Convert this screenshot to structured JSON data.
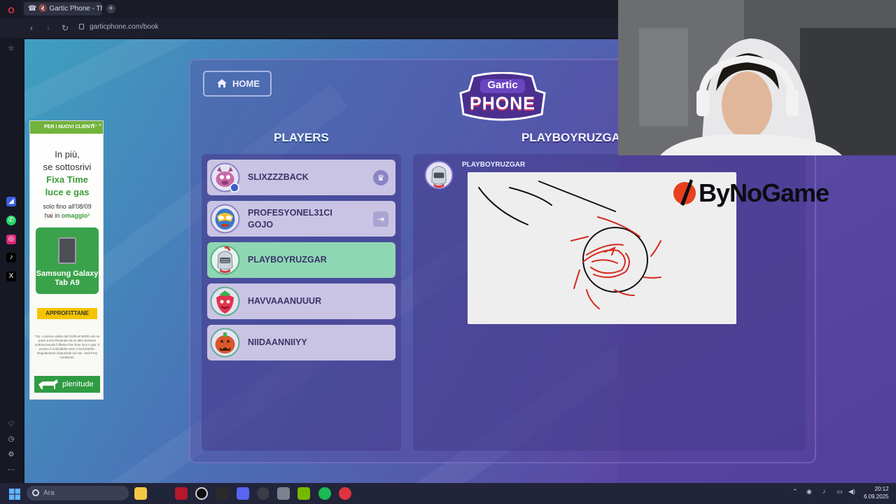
{
  "browser": {
    "tab_title": "☎ 🔇 Gartic Phone - The Te",
    "new_tab": "+",
    "url": "garticphone.com/book"
  },
  "game": {
    "home_label": "HOME",
    "logo_top": "Gartic",
    "logo_bottom": "PHONE",
    "players_title": "PLAYERS",
    "current_book_title": "PLAYBOYRUZGAR",
    "players": [
      {
        "name": "SLIXZZZBACK",
        "badge": "♛"
      },
      {
        "name": "PROFESYONEL31CI GOJO",
        "badge": "⇥"
      },
      {
        "name": "PLAYBOYRUZGAR",
        "badge": ""
      },
      {
        "name": "HAVVAAANUUUR",
        "badge": ""
      },
      {
        "name": "NIIDAANNIIYY",
        "badge": ""
      }
    ],
    "book_entry_author": "PLAYBOYRUZGAR"
  },
  "ad": {
    "top_label": "PER I NUOVI CLIENTI",
    "info": "i▷ ×",
    "line1": "In più,",
    "line2": "se sottosrivi",
    "line3": "Fixa Time",
    "line4": "luce e gas",
    "line5": "solo fino all'08/09",
    "line6_prefix": "hai in ",
    "line6_bold": "omaggio¹",
    "tablet_label": "Samsung Galaxy Tab A9",
    "cta": "APPROFITTANE",
    "fine_print": "¹Tip. o premio valido dal 01/09 al 08/09 solo se passi a Eni Plenitude da un altro fornitore sottoscrivendo l'offerta Fixa Time luce e gas. Il premio è richiedibile entro il 31/10/2025. Regolamento disponibile sul sito. Vedi FAQ condizioni.",
    "brand": "plenitude"
  },
  "overlay": {
    "sponsor": "ByNoGame"
  },
  "taskbar": {
    "search_placeholder": "Ara",
    "time": "20:12",
    "date": "6.09.2025"
  },
  "colors": {
    "active_row": "#8fd6b4",
    "row": "#c9c4e4",
    "stroke_red": "#d62a1f",
    "stroke_black": "#111111"
  }
}
